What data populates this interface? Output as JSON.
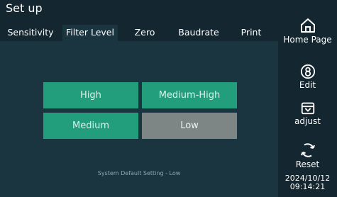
{
  "header": {
    "title": "Set up",
    "tabs": [
      {
        "label": "Sensitivity",
        "active": false
      },
      {
        "label": "Filter Level",
        "active": true
      },
      {
        "label": "Zero",
        "active": false
      },
      {
        "label": "Baudrate",
        "active": false
      },
      {
        "label": "Print",
        "active": false
      }
    ]
  },
  "filter": {
    "options": [
      {
        "label": "High",
        "selected": false
      },
      {
        "label": "Medium-High",
        "selected": false
      },
      {
        "label": "Medium",
        "selected": false
      },
      {
        "label": "Low",
        "selected": true
      }
    ],
    "note": "System Default Setting - Low"
  },
  "sidebar": {
    "home_label": "Home Page",
    "edit_label": "Edit",
    "adjust_label": "adjust",
    "reset_label": "Reset",
    "date": "2024/10/12",
    "time": "09:14:21"
  },
  "colors": {
    "option_bg": "#239e7d",
    "selected_bg": "#7e8585",
    "panel_bg": "#1a3440",
    "header_bg": "#14262f"
  }
}
